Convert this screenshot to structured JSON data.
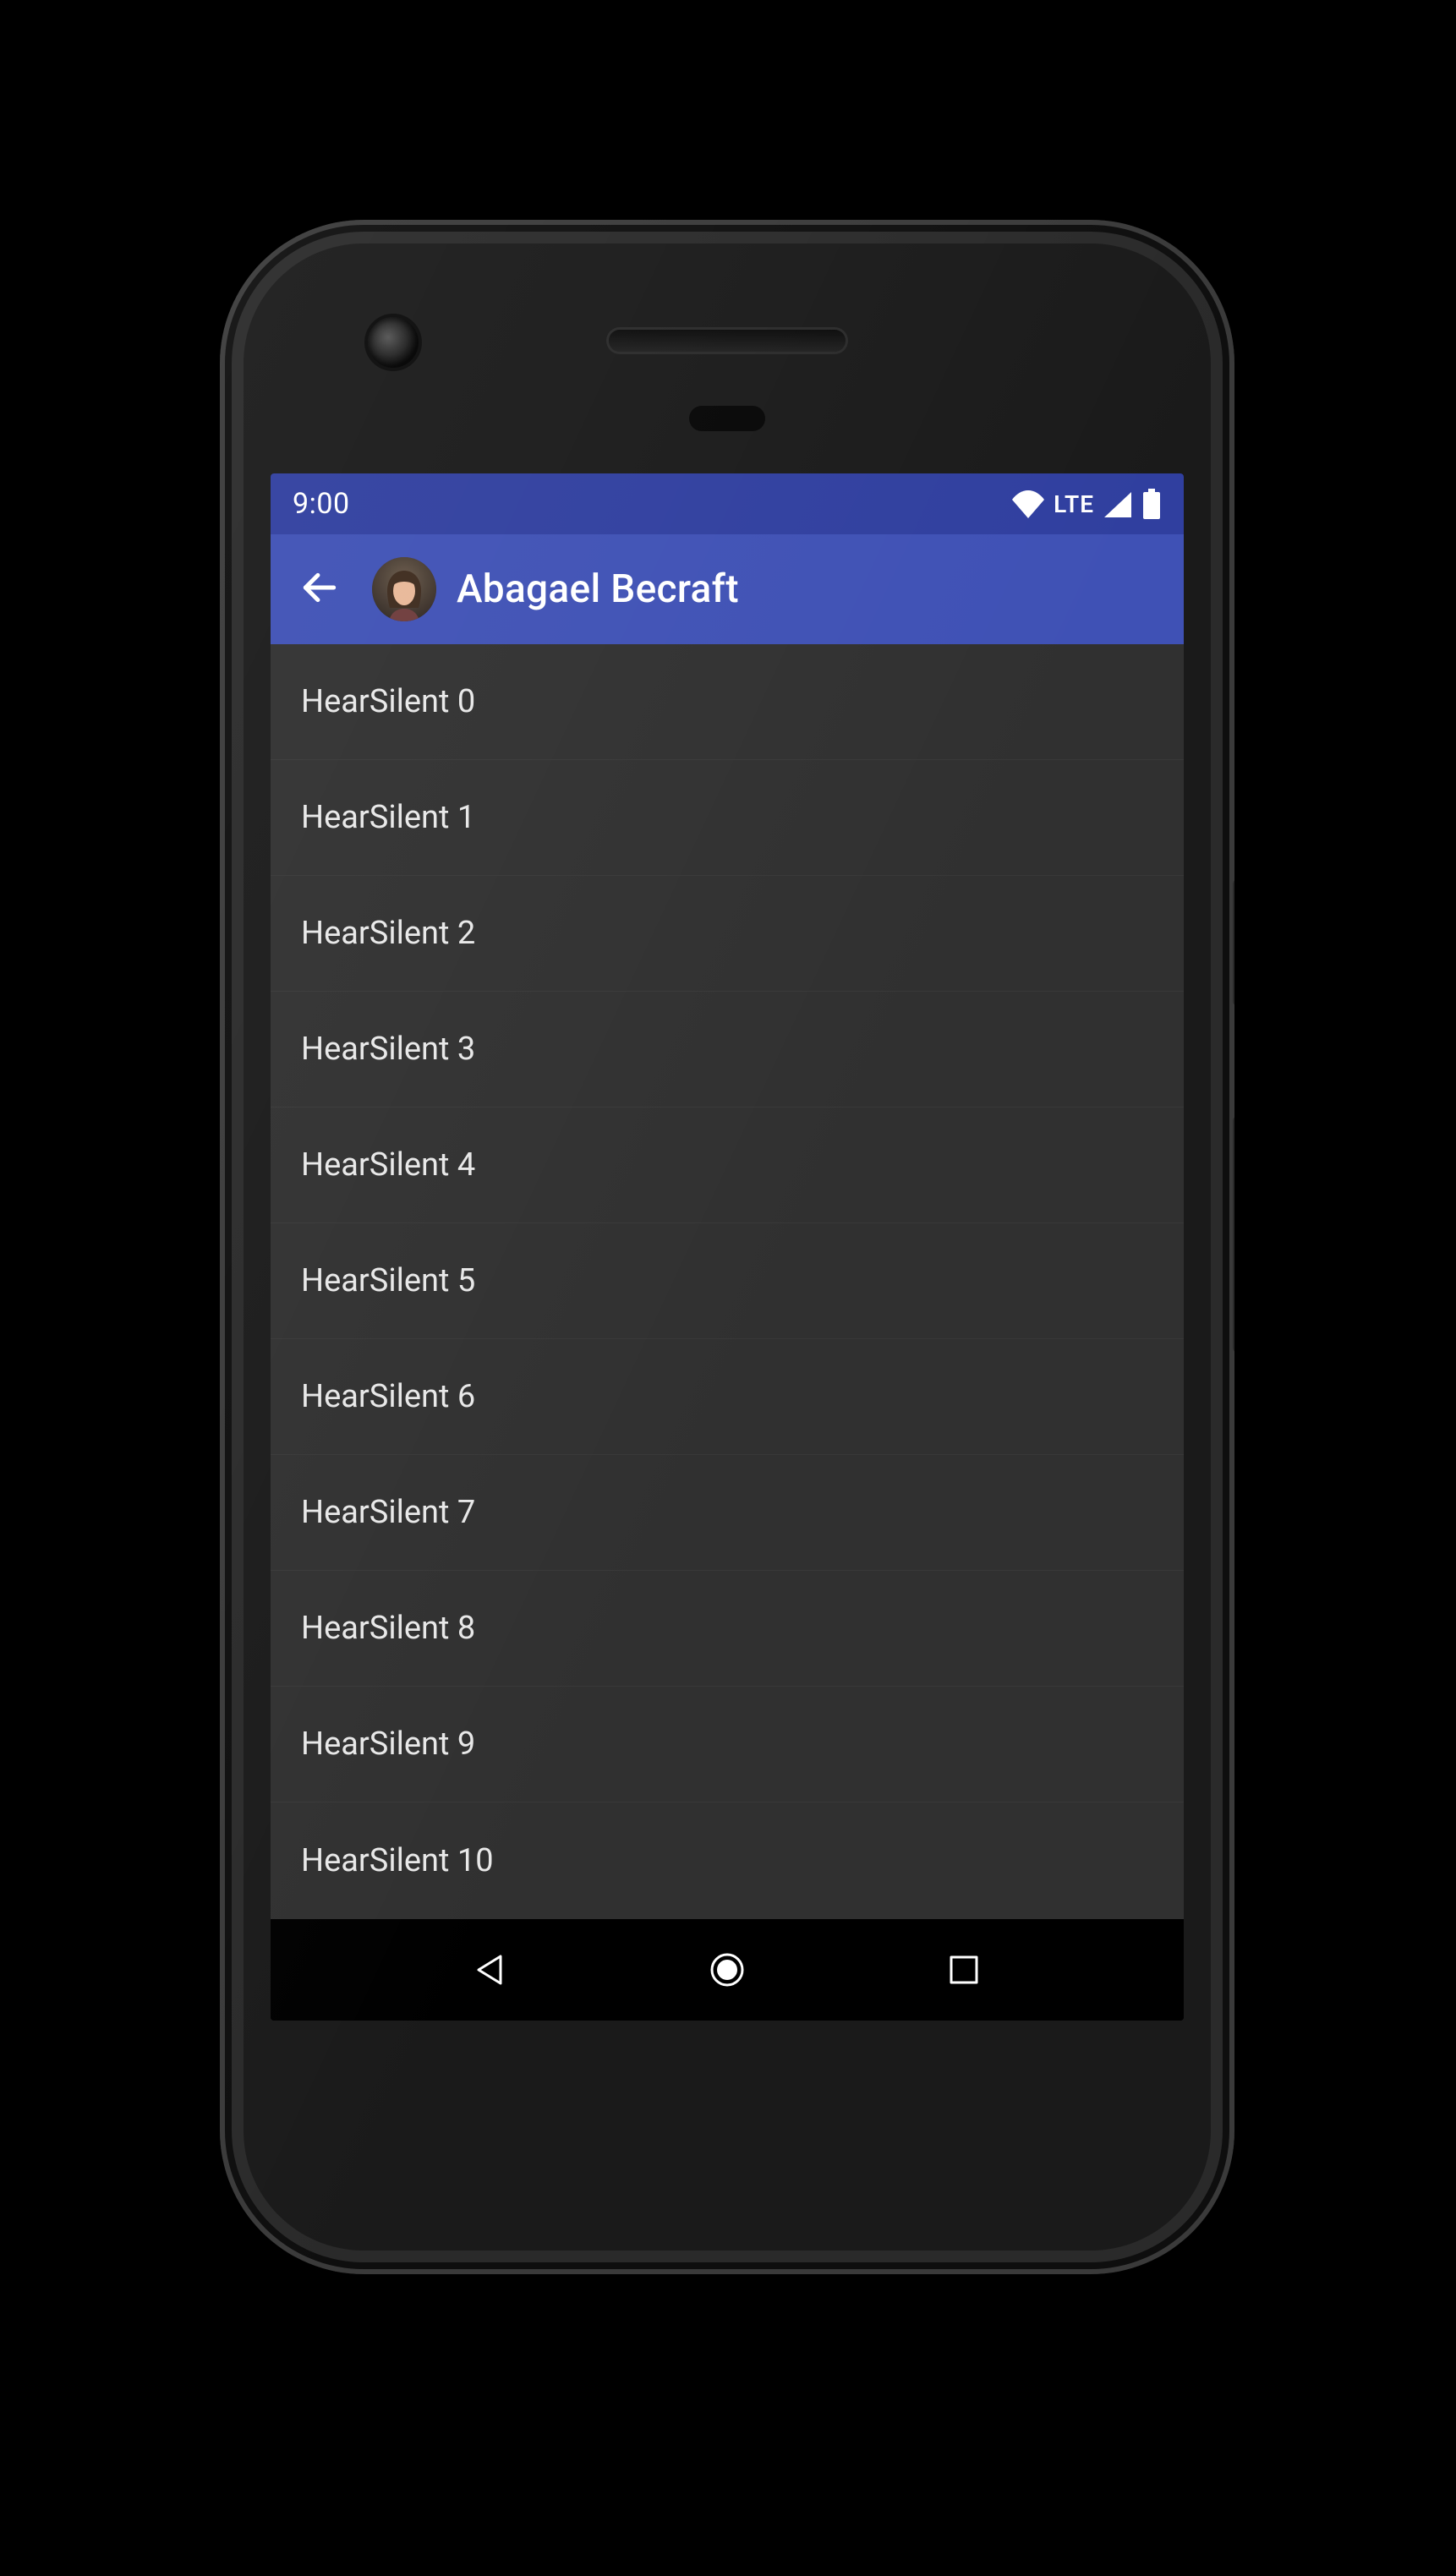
{
  "statusbar": {
    "time": "9:00",
    "network_label": "LTE"
  },
  "appbar": {
    "title": "Abagael Becraft"
  },
  "list": {
    "items": [
      {
        "label": "HearSilent 0"
      },
      {
        "label": "HearSilent 1"
      },
      {
        "label": "HearSilent 2"
      },
      {
        "label": "HearSilent 3"
      },
      {
        "label": "HearSilent 4"
      },
      {
        "label": "HearSilent 5"
      },
      {
        "label": "HearSilent 6"
      },
      {
        "label": "HearSilent 7"
      },
      {
        "label": "HearSilent 8"
      },
      {
        "label": "HearSilent 9"
      },
      {
        "label": "HearSilent 10"
      }
    ]
  }
}
